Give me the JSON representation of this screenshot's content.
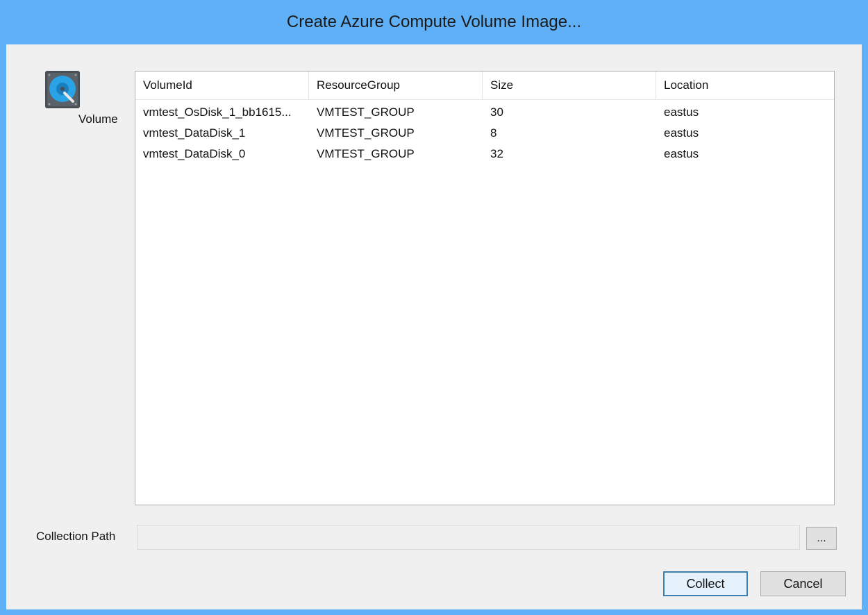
{
  "window": {
    "title": "Create Azure Compute Volume Image..."
  },
  "volume_section": {
    "icon": "hard-disk-icon",
    "label": "Volume"
  },
  "table": {
    "columns": [
      "VolumeId",
      "ResourceGroup",
      "Size",
      "Location"
    ],
    "rows": [
      [
        "vmtest_OsDisk_1_bb1615...",
        "VMTEST_GROUP",
        "30",
        "eastus"
      ],
      [
        "vmtest_DataDisk_1",
        "VMTEST_GROUP",
        "8",
        "eastus"
      ],
      [
        "vmtest_DataDisk_0",
        "VMTEST_GROUP",
        "32",
        "eastus"
      ]
    ]
  },
  "collection_path": {
    "label": "Collection Path",
    "value": "",
    "browse_label": "..."
  },
  "buttons": {
    "collect": "Collect",
    "cancel": "Cancel"
  },
  "colors": {
    "titlebar": "#5fb0f6",
    "disk_icon": "#2aa3e6"
  }
}
